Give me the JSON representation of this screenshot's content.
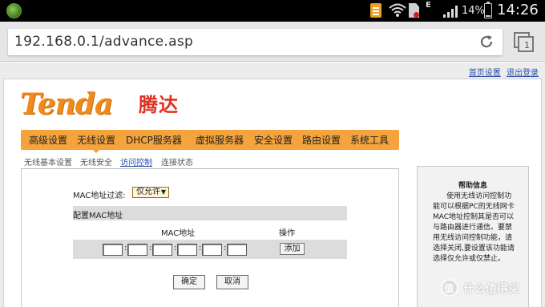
{
  "status_bar": {
    "network_type": "E",
    "battery_percent": "14%",
    "battery_level": 0.14,
    "time": "14:26",
    "icons": [
      "app-icon",
      "document-icon",
      "wifi-icon",
      "no-sim-icon",
      "signal-icon",
      "battery-icon"
    ]
  },
  "browser": {
    "url": "192.168.0.1/advance.asp",
    "icons": [
      "reload-icon",
      "tabs-icon"
    ],
    "tab_count": "1"
  },
  "page": {
    "top_links": [
      "首页设置",
      "退出登录"
    ],
    "logo_text": "Tenda",
    "logo_cn": "腾达",
    "main_nav": [
      "高级设置",
      "无线设置",
      "DHCP服务器",
      "虚拟服务器",
      "安全设置",
      "路由设置",
      "系统工具"
    ],
    "active_main_nav": "无线设置",
    "sub_nav": [
      "无线基本设置",
      "无线安全",
      "访问控制",
      "连接状态"
    ],
    "active_sub_nav": "访问控制",
    "form": {
      "mac_filter_label": "MAC地址过滤:",
      "mac_filter_value": "仅允许",
      "config_heading": "配置MAC地址",
      "col_mac": "MAC地址",
      "col_action": "操作",
      "mac_separator": ":",
      "add_label": "添加",
      "ok_label": "确定",
      "cancel_label": "取消"
    },
    "help": {
      "title": "帮助信息",
      "body": "使用无线访问控制功能可以根据PC的无线网卡MAC地址控制其是否可以与路由器进行通信。要禁用无线访问控制功能，请选择关闭,要设置该功能请选择仅允许或仅禁止。"
    }
  },
  "watermark": {
    "text": "什么值得买",
    "icon": "zhidemai-logo"
  }
}
